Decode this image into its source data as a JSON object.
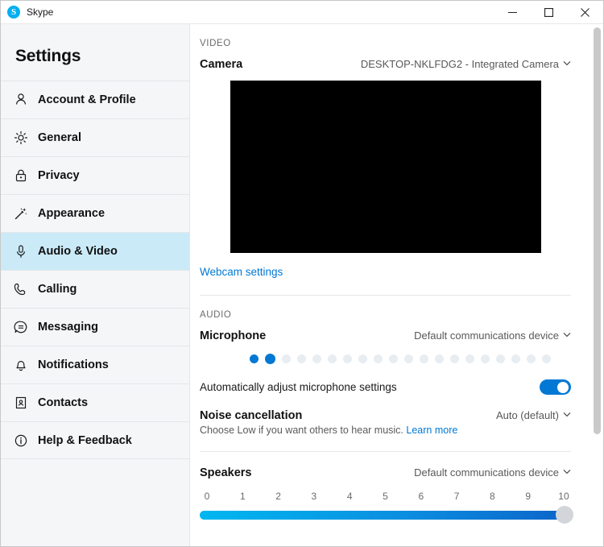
{
  "window": {
    "title": "Skype",
    "logo_icon": "skype-logo-icon",
    "logo_letter": "S",
    "minimize_label": "─",
    "maximize_label": "☐",
    "close_label": "✕"
  },
  "sidebar": {
    "heading": "Settings",
    "items": [
      {
        "label": "Account & Profile",
        "icon": "person-icon",
        "selected": false
      },
      {
        "label": "General",
        "icon": "gear-icon",
        "selected": false
      },
      {
        "label": "Privacy",
        "icon": "lock-icon",
        "selected": false
      },
      {
        "label": "Appearance",
        "icon": "magic-wand-icon",
        "selected": false
      },
      {
        "label": "Audio & Video",
        "icon": "microphone-icon",
        "selected": true
      },
      {
        "label": "Calling",
        "icon": "phone-icon",
        "selected": false
      },
      {
        "label": "Messaging",
        "icon": "chat-bubble-icon",
        "selected": false
      },
      {
        "label": "Notifications",
        "icon": "bell-icon",
        "selected": false
      },
      {
        "label": "Contacts",
        "icon": "contacts-book-icon",
        "selected": false
      },
      {
        "label": "Help & Feedback",
        "icon": "info-circle-icon",
        "selected": false
      }
    ]
  },
  "main": {
    "video_section_label": "VIDEO",
    "camera_label": "Camera",
    "camera_value": "DESKTOP-NKLFDG2 - Integrated Camera",
    "webcam_settings_link": "Webcam settings",
    "audio_section_label": "AUDIO",
    "microphone_label": "Microphone",
    "microphone_value": "Default communications device",
    "mic_level": {
      "total_dots": 20,
      "active_dots": 2
    },
    "auto_adjust_label": "Automatically adjust microphone settings",
    "auto_adjust_on": true,
    "noise_cancellation_label": "Noise cancellation",
    "noise_cancellation_value": "Auto (default)",
    "noise_cancellation_hint": "Choose Low if you want others to hear music.",
    "noise_cancellation_link": "Learn more",
    "speakers_label": "Speakers",
    "speakers_value": "Default communications device",
    "speaker_ticks": [
      "0",
      "1",
      "2",
      "3",
      "4",
      "5",
      "6",
      "7",
      "8",
      "9",
      "10"
    ],
    "speaker_volume": 10,
    "chevron": "⌄"
  },
  "colors": {
    "accent": "#0078d4",
    "selected_nav": "#cbeaf8",
    "link": "#0078d4",
    "sidebar_bg": "#f4f6f8"
  }
}
